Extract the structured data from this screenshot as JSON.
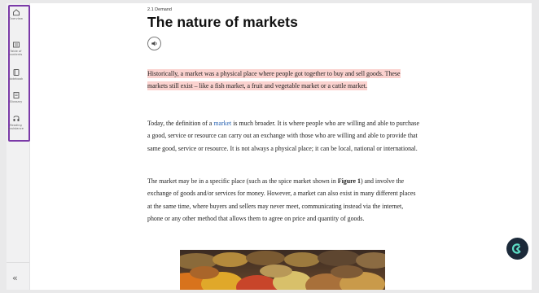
{
  "sidebar": {
    "items": [
      {
        "label": "Overview",
        "icon": "home-icon"
      },
      {
        "label": "Table of contents",
        "icon": "list-icon"
      },
      {
        "label": "Notebook",
        "icon": "notebook-icon"
      },
      {
        "label": "Glossary",
        "icon": "glossary-icon"
      },
      {
        "label": "Reading assistance",
        "icon": "reading-assistance-icon"
      }
    ],
    "collapse_label": "«",
    "highlight_color": "#7b3aa8"
  },
  "main": {
    "section": "2.1 Demand",
    "title": "The nature of markets",
    "paragraphs": {
      "p1": "Historically, a market was a physical place where people got together to buy and sell goods. These markets still exist – like a fish market, a fruit and vegetable market or a cattle market.",
      "p2_before": "Today, the definition of a ",
      "p2_link": "market",
      "p2_after": " is much broader. It is where people who are willing and able to purchase a good, service or resource can carry out an exchange with those who are willing and able to provide that same good, service or resource. It is not always a physical place; it can be local, national or international.",
      "p3_before": "The market may be in a specific place (such as the spice market shown in ",
      "p3_bold": "Figure 1",
      "p3_after": ") and involve the exchange of goods and/or services for money. However, a market can also exist in many different places at the same time, where buyers and sellers may never meet, communicating instead via the internet, phone or any other method that allows them to agree on price and quantity of goods."
    },
    "highlight_color": "#fbd2cf",
    "link_color": "#2a64b2"
  },
  "assistant": {
    "icon": "assistant-logo-icon"
  }
}
